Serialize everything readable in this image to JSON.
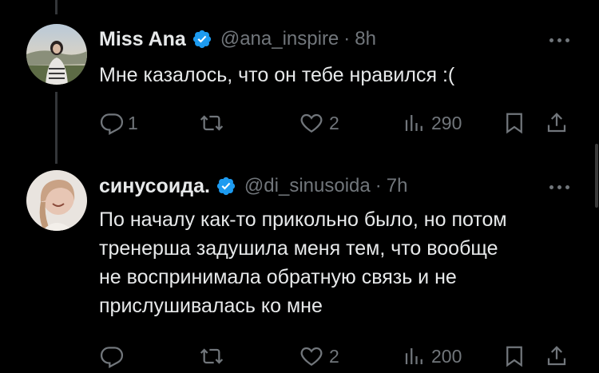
{
  "tweets": [
    {
      "name": "Miss Ana",
      "handle": "@ana_inspire",
      "separator": "·",
      "time": "8h",
      "text": "Мне казалось, что он тебе нравился :(",
      "replies": "1",
      "reposts": "",
      "likes": "2",
      "views": "290"
    },
    {
      "name": "синусоида.",
      "handle": "@di_sinusoida",
      "separator": "·",
      "time": "7h",
      "text_lines": [
        "По началу как-то прикольно было, но потом",
        "тренерша задушила меня тем, что вообще",
        "не воспринимала обратную связь и не",
        "прислушивалась ко мне"
      ],
      "replies": "",
      "reposts": "",
      "likes": "2",
      "views": "200"
    }
  ],
  "colors": {
    "background": "#000000",
    "text": "#e7e9ea",
    "secondary": "#71767b",
    "verified": "#1d9bf0"
  },
  "icons": [
    "reply-icon",
    "repost-icon",
    "like-icon",
    "views-icon",
    "bookmark-icon",
    "share-icon",
    "more-icon",
    "verified-badge-icon"
  ]
}
